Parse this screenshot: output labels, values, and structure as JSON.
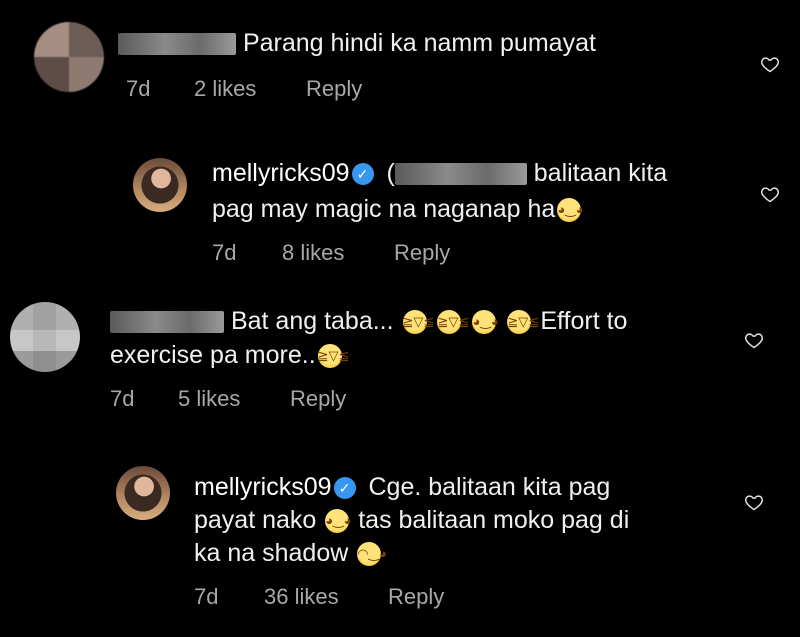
{
  "comments": [
    {
      "username_blurred": true,
      "text": "Parang hindi ka namm pumayat",
      "time": "7d",
      "likes": "2 likes",
      "reply": "Reply"
    },
    {
      "username": "mellyricks09",
      "verified": true,
      "mention_blurred": true,
      "text_line1": "balitaan kita",
      "text_line2": "pag may magic na naganap ha",
      "emoji": "grinning-sweat-emoji",
      "time": "7d",
      "likes": "8 likes",
      "reply": "Reply"
    },
    {
      "username_blurred": true,
      "text_line1": "Bat ang taba...",
      "emojis": [
        "rofl-emoji",
        "rofl-emoji",
        "grinning-sweat-emoji",
        "rofl-emoji"
      ],
      "text_line1_end": "Effort to",
      "text_line2": "exercise pa more..",
      "time": "7d",
      "likes": "5 likes",
      "reply": "Reply"
    },
    {
      "username": "mellyricks09",
      "verified": true,
      "text_line1": "Cge. balitaan kita pag",
      "text_line2a": "payat nako",
      "text_line2b": "tas balitaan moko pag di",
      "text_line3": "ka na shadow",
      "emojis": [
        "grinning-sweat-emoji",
        "wink-emoji"
      ],
      "time": "7d",
      "likes": "36 likes",
      "reply": "Reply"
    }
  ],
  "icons": {
    "like": "heart-outline-icon",
    "verified": "verified-badge-icon"
  },
  "colors": {
    "background": "#000000",
    "text": "#f0f0f0",
    "meta": "#a8a8a8",
    "verified": "#3897f0"
  }
}
